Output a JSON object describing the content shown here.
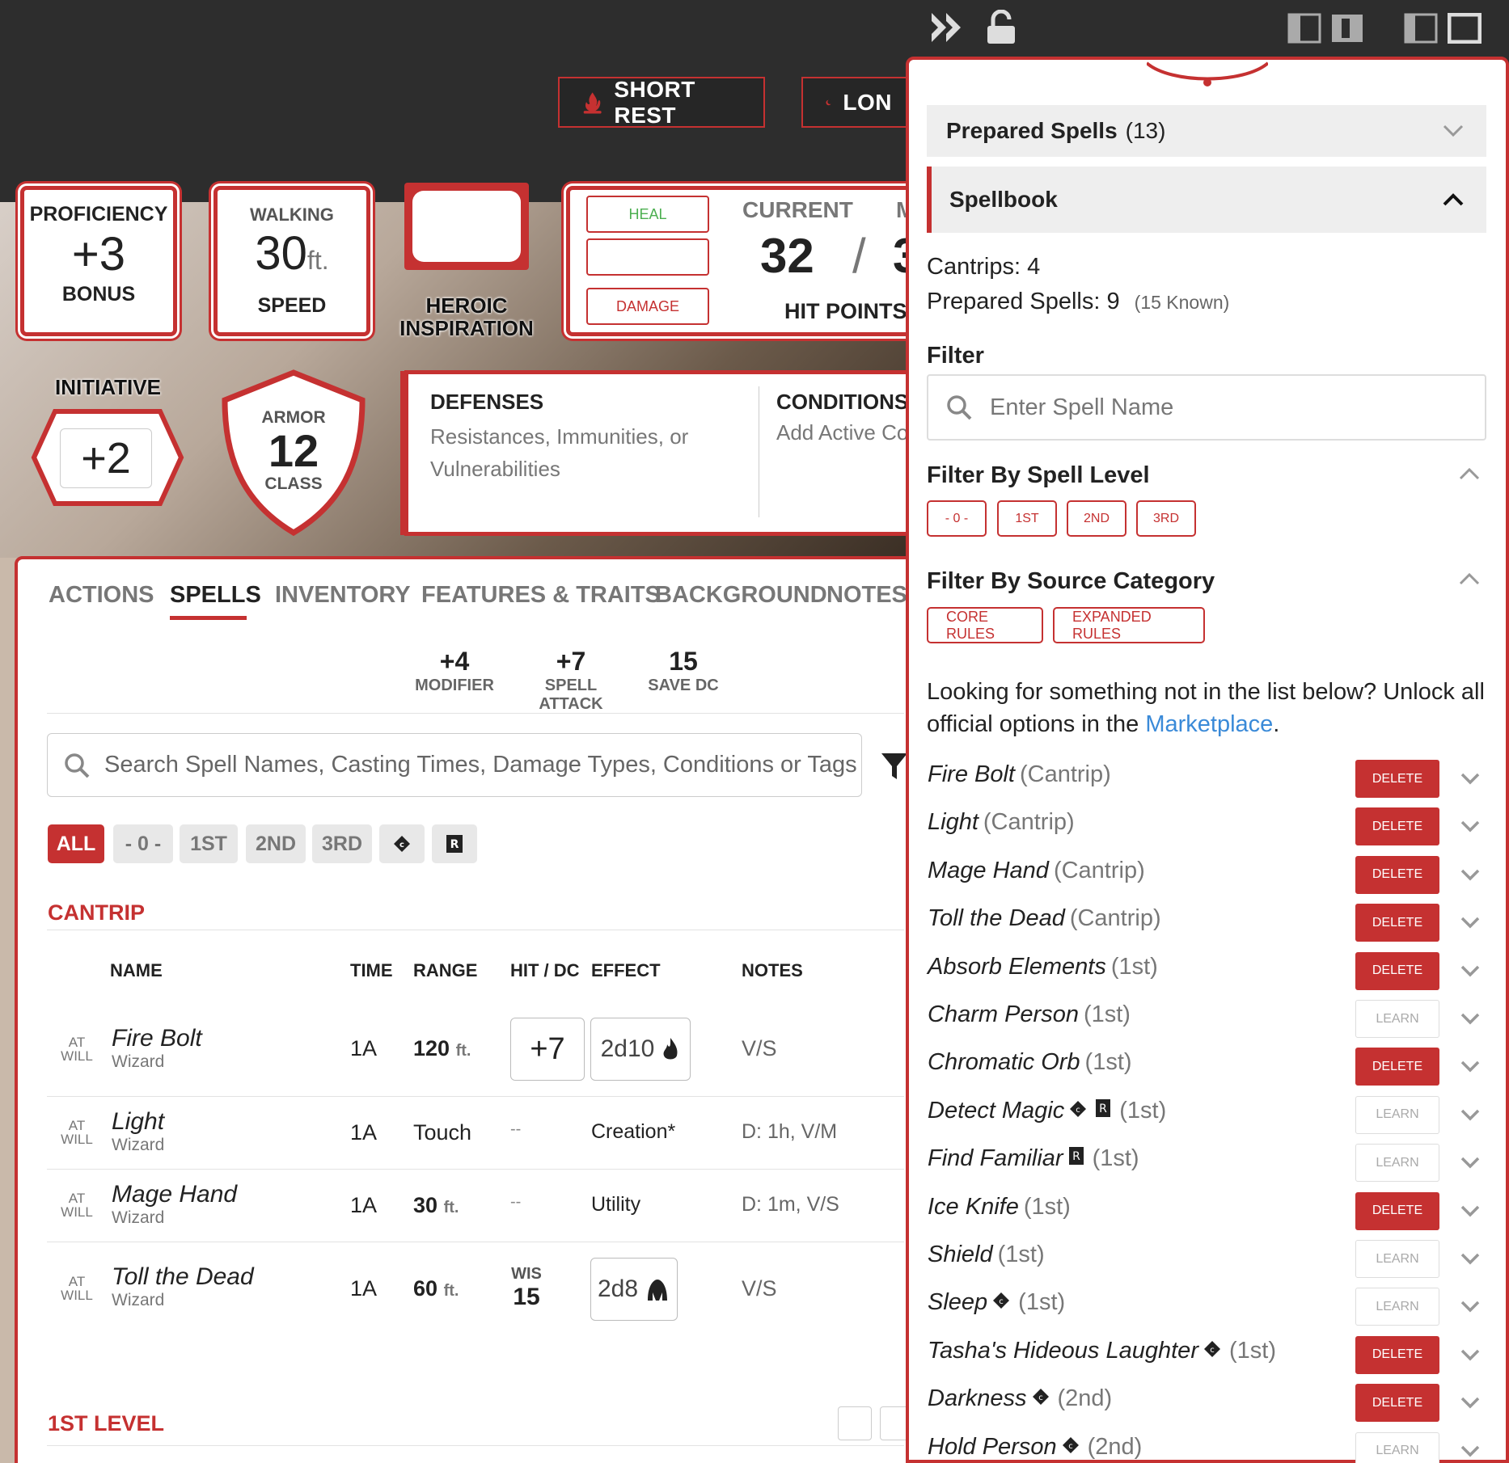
{
  "top_controls": {
    "short_rest": "SHORT REST",
    "long_rest": "LON"
  },
  "stats": {
    "proficiency": {
      "label": "PROFICIENCY",
      "value": "+3",
      "sub": "BONUS"
    },
    "speed": {
      "label": "WALKING",
      "value": "30",
      "unit": "ft.",
      "sub": "SPEED"
    },
    "heroic": {
      "line1": "HEROIC",
      "line2": "INSPIRATION"
    },
    "hp": {
      "heal": "HEAL",
      "damage": "DAMAGE",
      "current_label": "CURRENT",
      "current": "32",
      "slash": "/",
      "max_partial": "3",
      "max_label_partial": "M",
      "label": "HIT POINTS"
    },
    "initiative": {
      "label": "INITIATIVE",
      "value": "+2"
    },
    "armor": {
      "top": "ARMOR",
      "value": "12",
      "bottom": "CLASS"
    },
    "defenses": {
      "title": "DEFENSES",
      "text": "Resistances, Immunities, or Vulnerabilities"
    },
    "conditions": {
      "title": "CONDITIONS",
      "text": "Add Active Co"
    }
  },
  "tabs": [
    "ACTIONS",
    "SPELLS",
    "INVENTORY",
    "FEATURES & TRAITS",
    "BACKGROUND",
    "NOTES"
  ],
  "spell_stats": [
    {
      "value": "+4",
      "label": "MODIFIER"
    },
    {
      "value": "+7",
      "label": "SPELL ATTACK"
    },
    {
      "value": "15",
      "label": "SAVE DC"
    }
  ],
  "search": {
    "placeholder": "Search Spell Names, Casting Times, Damage Types, Conditions or Tags"
  },
  "level_filters": [
    "ALL",
    "- 0 -",
    "1ST",
    "2ND",
    "3RD"
  ],
  "section_cantrip": "CANTRIP",
  "section_1st": "1ST LEVEL",
  "columns": {
    "name": "NAME",
    "time": "TIME",
    "range": "RANGE",
    "hit": "HIT / DC",
    "effect": "EFFECT",
    "notes": "NOTES"
  },
  "cantrips": [
    {
      "at": "AT",
      "will": "WILL",
      "name": "Fire Bolt",
      "source": "Wizard",
      "time": "1A",
      "range": "120",
      "range_unit": "ft.",
      "hit": "+7",
      "effect": "2d10",
      "notes": "V/S"
    },
    {
      "at": "AT",
      "will": "WILL",
      "name": "Light",
      "source": "Wizard",
      "time": "1A",
      "range": "Touch",
      "hit": "--",
      "effect": "Creation*",
      "notes": "D: 1h, V/M"
    },
    {
      "at": "AT",
      "will": "WILL",
      "name": "Mage Hand",
      "source": "Wizard",
      "time": "1A",
      "range": "30",
      "range_unit": "ft.",
      "hit": "--",
      "effect": "Utility",
      "notes": "D: 1m, V/S"
    },
    {
      "at": "AT",
      "will": "WILL",
      "name": "Toll the Dead",
      "source": "Wizard",
      "time": "1A",
      "range": "60",
      "range_unit": "ft.",
      "hit_label": "WIS",
      "hit": "15",
      "effect": "2d8",
      "notes": "V/S"
    }
  ],
  "side": {
    "prepared_title": "Prepared Spells",
    "prepared_count": "(13)",
    "spellbook_title": "Spellbook",
    "cantrips_line": "Cantrips: 4",
    "prepared_line": "Prepared Spells: 9",
    "known": "(15 Known)",
    "filter_title": "Filter",
    "filter_placeholder": "Enter Spell Name",
    "level_title": "Filter By Spell Level",
    "level_buttons": [
      "- 0 -",
      "1ST",
      "2ND",
      "3RD"
    ],
    "source_title": "Filter By Source Category",
    "source_buttons": [
      "CORE RULES",
      "EXPANDED RULES"
    ],
    "promo_text": "Looking for something not in the list below? Unlock all official options in the",
    "promo_link": "Marketplace",
    "promo_end": ".",
    "spells": [
      {
        "name": "Fire Bolt",
        "level": "(Cantrip)",
        "action": "DELETE"
      },
      {
        "name": "Light",
        "level": "(Cantrip)",
        "action": "DELETE"
      },
      {
        "name": "Mage Hand",
        "level": "(Cantrip)",
        "action": "DELETE"
      },
      {
        "name": "Toll the Dead",
        "level": "(Cantrip)",
        "action": "DELETE"
      },
      {
        "name": "Absorb Elements",
        "level": "(1st)",
        "action": "DELETE"
      },
      {
        "name": "Charm Person",
        "level": "(1st)",
        "action": "LEARN"
      },
      {
        "name": "Chromatic Orb",
        "level": "(1st)",
        "action": "DELETE"
      },
      {
        "name": "Detect Magic",
        "level": "(1st)",
        "action": "LEARN"
      },
      {
        "name": "Find Familiar",
        "level": "(1st)",
        "action": "LEARN"
      },
      {
        "name": "Ice Knife",
        "level": "(1st)",
        "action": "DELETE"
      },
      {
        "name": "Shield",
        "level": "(1st)",
        "action": "LEARN"
      },
      {
        "name": "Sleep",
        "level": "(1st)",
        "action": "LEARN"
      },
      {
        "name": "Tasha's Hideous Laughter",
        "level": "(1st)",
        "action": "DELETE"
      },
      {
        "name": "Darkness",
        "level": "(2nd)",
        "action": "DELETE"
      },
      {
        "name": "Hold Person",
        "level": "(2nd)",
        "action": "LEARN"
      }
    ]
  },
  "colors": {
    "accent": "#c53131",
    "link": "#3a8ad8",
    "dark": "#2d2d2d"
  }
}
